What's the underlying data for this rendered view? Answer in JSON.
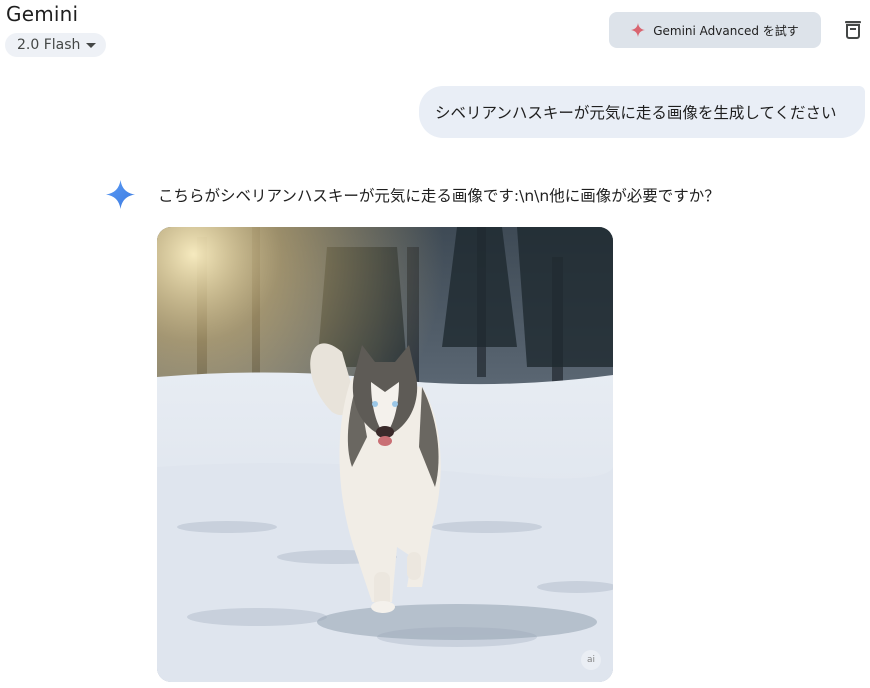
{
  "header": {
    "title": "Gemini",
    "model_selector": "2.0 Flash",
    "upgrade_label": "Gemini Advanced を試す",
    "icons": {
      "model_caret": "chevron-down-icon",
      "upgrade": "sparkle-icon",
      "delete": "trash-icon"
    }
  },
  "conversation": {
    "user_message": "シベリアンハスキーが元気に走る画像を生成してください",
    "assistant": {
      "avatar_icon": "gemini-sparkle-icon",
      "text": "こちらがシベリアンハスキーが元気に走る画像です:\\n\\n他に画像が必要ですか？",
      "image": {
        "description": "Siberian husky running toward the camera on snow with sunlit forest background",
        "badge": "ai"
      }
    }
  },
  "colors": {
    "upgrade_bg": "#dde3ea",
    "chip_bg": "#eef1f6",
    "user_bubble_bg": "#e9eef6",
    "sparkle_blue": "#4a8ef0",
    "sparkle_red": "#d96570"
  }
}
